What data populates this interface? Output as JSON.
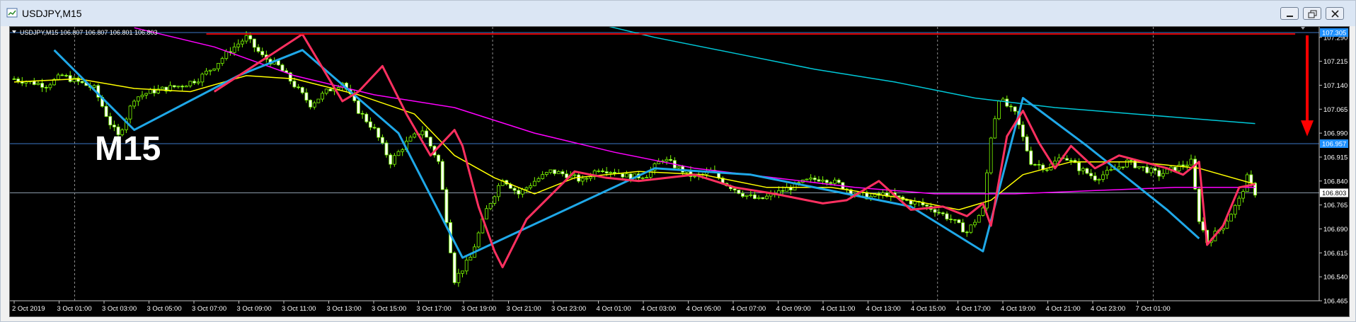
{
  "window": {
    "title": "USDJPY,M15",
    "minimize_icon": "minimize-icon",
    "restore_icon": "restore-icon",
    "close_icon": "close-icon"
  },
  "chart_header": {
    "symbol_info": "USDJPY,M15  106.807 106.807 106.801 106.803"
  },
  "overlay_label": "M15",
  "colors": {
    "background": "#000000",
    "candles": "#7cfc00",
    "ma_yellow": "#ffff00",
    "ma_magenta": "#ff00ff",
    "ma_cyan": "#00c8d8",
    "zigzag_blue": "#1fa8e8",
    "zigzag_red": "#ff3060",
    "resistance_line": "#dd0000",
    "arrow": "#ff0000",
    "hline": "#3c78c8",
    "grid": "#8c8c8c",
    "price_marker_blue": "#1e90ff",
    "current_price_marker": "#ffffff"
  },
  "chart_data": {
    "type": "line",
    "symbol": "USDJPY",
    "timeframe": "M15",
    "ylim": [
      106.465,
      107.305
    ],
    "y_ticks": [
      "107.290",
      "107.215",
      "107.140",
      "107.065",
      "106.990",
      "106.915",
      "106.840",
      "106.765",
      "106.690",
      "106.615",
      "106.540",
      "106.465"
    ],
    "x_ticks": [
      "2 Oct 2019",
      "3 Oct 01:00",
      "3 Oct 03:00",
      "3 Oct 05:00",
      "3 Oct 07:00",
      "3 Oct 09:00",
      "3 Oct 11:00",
      "3 Oct 13:00",
      "3 Oct 15:00",
      "3 Oct 17:00",
      "3 Oct 19:00",
      "3 Oct 21:00",
      "3 Oct 23:00",
      "4 Oct 01:00",
      "4 Oct 03:00",
      "4 Oct 05:00",
      "4 Oct 07:00",
      "4 Oct 09:00",
      "4 Oct 11:00",
      "4 Oct 13:00",
      "4 Oct 15:00",
      "4 Oct 17:00",
      "4 Oct 19:00",
      "4 Oct 21:00",
      "4 Oct 23:00",
      "7 Oct 01:00"
    ],
    "price_markers": [
      {
        "label": "107.305",
        "value": 107.305,
        "style": "blue"
      },
      {
        "label": "106.957",
        "value": 106.957,
        "style": "blue"
      },
      {
        "label": "106.803",
        "value": 106.803,
        "style": "current"
      }
    ],
    "horizontal_lines": [
      107.305,
      106.957,
      106.803
    ],
    "close_series": [
      [
        0,
        107.16
      ],
      [
        2,
        107.15
      ],
      [
        4,
        107.14
      ],
      [
        6,
        107.17
      ],
      [
        8,
        107.15
      ],
      [
        10,
        107.13
      ],
      [
        12,
        107.02
      ],
      [
        13,
        106.98
      ],
      [
        15,
        107.1
      ],
      [
        17,
        107.12
      ],
      [
        19,
        107.13
      ],
      [
        21,
        107.14
      ],
      [
        23,
        107.16
      ],
      [
        25,
        107.2
      ],
      [
        27,
        107.25
      ],
      [
        29,
        107.29
      ],
      [
        31,
        107.23
      ],
      [
        33,
        107.2
      ],
      [
        35,
        107.14
      ],
      [
        37,
        107.08
      ],
      [
        39,
        107.12
      ],
      [
        41,
        107.15
      ],
      [
        43,
        107.06
      ],
      [
        45,
        107.0
      ],
      [
        47,
        106.9
      ],
      [
        49,
        106.96
      ],
      [
        51,
        107.0
      ],
      [
        53,
        106.9
      ],
      [
        54,
        106.72
      ],
      [
        55,
        106.53
      ],
      [
        57,
        106.6
      ],
      [
        59,
        106.75
      ],
      [
        61,
        106.85
      ],
      [
        63,
        106.8
      ],
      [
        65,
        106.84
      ],
      [
        67,
        106.87
      ],
      [
        69,
        106.86
      ],
      [
        71,
        106.84
      ],
      [
        73,
        106.88
      ],
      [
        75,
        106.87
      ],
      [
        77,
        106.85
      ],
      [
        79,
        106.86
      ],
      [
        81,
        106.91
      ],
      [
        83,
        106.88
      ],
      [
        85,
        106.85
      ],
      [
        87,
        106.87
      ],
      [
        89,
        106.83
      ],
      [
        91,
        106.8
      ],
      [
        93,
        106.78
      ],
      [
        95,
        106.8
      ],
      [
        97,
        106.82
      ],
      [
        99,
        106.84
      ],
      [
        101,
        106.85
      ],
      [
        103,
        106.83
      ],
      [
        105,
        106.8
      ],
      [
        107,
        106.79
      ],
      [
        109,
        106.8
      ],
      [
        111,
        106.78
      ],
      [
        113,
        106.77
      ],
      [
        115,
        106.75
      ],
      [
        117,
        106.72
      ],
      [
        119,
        106.68
      ],
      [
        121,
        106.75
      ],
      [
        122,
        106.98
      ],
      [
        123,
        107.1
      ],
      [
        125,
        107.05
      ],
      [
        127,
        106.9
      ],
      [
        129,
        106.88
      ],
      [
        131,
        106.92
      ],
      [
        133,
        106.88
      ],
      [
        135,
        106.85
      ],
      [
        137,
        106.87
      ],
      [
        139,
        106.9
      ],
      [
        141,
        106.88
      ],
      [
        143,
        106.86
      ],
      [
        145,
        106.88
      ],
      [
        147,
        106.9
      ],
      [
        148,
        106.72
      ],
      [
        149,
        106.65
      ],
      [
        151,
        106.7
      ],
      [
        153,
        106.78
      ],
      [
        154,
        106.85
      ],
      [
        155,
        106.803
      ]
    ],
    "ma_yellow": [
      [
        0,
        107.15
      ],
      [
        8,
        107.16
      ],
      [
        15,
        107.13
      ],
      [
        22,
        107.12
      ],
      [
        29,
        107.17
      ],
      [
        35,
        107.16
      ],
      [
        43,
        107.11
      ],
      [
        50,
        107.05
      ],
      [
        55,
        106.92
      ],
      [
        60,
        106.85
      ],
      [
        65,
        106.8
      ],
      [
        70,
        106.85
      ],
      [
        78,
        106.87
      ],
      [
        86,
        106.86
      ],
      [
        94,
        106.82
      ],
      [
        102,
        106.82
      ],
      [
        110,
        106.79
      ],
      [
        118,
        106.75
      ],
      [
        122,
        106.78
      ],
      [
        126,
        106.86
      ],
      [
        132,
        106.9
      ],
      [
        140,
        106.9
      ],
      [
        148,
        106.88
      ],
      [
        155,
        106.83
      ]
    ],
    "ma_magenta": [
      [
        15,
        107.32
      ],
      [
        25,
        107.26
      ],
      [
        35,
        107.17
      ],
      [
        45,
        107.11
      ],
      [
        55,
        107.07
      ],
      [
        65,
        106.99
      ],
      [
        75,
        106.93
      ],
      [
        85,
        106.88
      ],
      [
        95,
        106.85
      ],
      [
        105,
        106.82
      ],
      [
        115,
        106.8
      ],
      [
        125,
        106.8
      ],
      [
        135,
        106.81
      ],
      [
        145,
        106.82
      ],
      [
        155,
        106.82
      ]
    ],
    "ma_cyan": [
      [
        60,
        107.42
      ],
      [
        70,
        107.35
      ],
      [
        80,
        107.29
      ],
      [
        90,
        107.24
      ],
      [
        100,
        107.19
      ],
      [
        110,
        107.15
      ],
      [
        120,
        107.1
      ],
      [
        130,
        107.07
      ],
      [
        140,
        107.05
      ],
      [
        150,
        107.03
      ],
      [
        155,
        107.02
      ]
    ],
    "zigzag_blue": [
      [
        5,
        107.25
      ],
      [
        15,
        107.0
      ],
      [
        28,
        107.17
      ],
      [
        36,
        107.25
      ],
      [
        48,
        106.99
      ],
      [
        56,
        106.6
      ],
      [
        62,
        106.67
      ],
      [
        80,
        106.88
      ],
      [
        92,
        106.86
      ],
      [
        112,
        106.76
      ],
      [
        121,
        106.62
      ],
      [
        126,
        107.1
      ],
      [
        134,
        106.95
      ],
      [
        144,
        106.75
      ],
      [
        148,
        106.66
      ]
    ],
    "zigzag_red": [
      [
        25,
        107.12
      ],
      [
        36,
        107.3
      ],
      [
        41,
        107.09
      ],
      [
        43,
        107.12
      ],
      [
        46,
        107.2
      ],
      [
        49,
        107.05
      ],
      [
        52,
        106.92
      ],
      [
        55,
        107.0
      ],
      [
        56,
        106.95
      ],
      [
        58,
        106.76
      ],
      [
        60,
        106.62
      ],
      [
        61,
        106.57
      ],
      [
        64,
        106.72
      ],
      [
        70,
        106.87
      ],
      [
        74,
        106.85
      ],
      [
        78,
        106.84
      ],
      [
        85,
        106.86
      ],
      [
        90,
        106.82
      ],
      [
        95,
        106.8
      ],
      [
        101,
        106.77
      ],
      [
        104,
        106.78
      ],
      [
        108,
        106.84
      ],
      [
        112,
        106.75
      ],
      [
        116,
        106.76
      ],
      [
        119,
        106.73
      ],
      [
        121,
        106.77
      ],
      [
        122,
        106.7
      ],
      [
        124,
        106.98
      ],
      [
        126,
        107.06
      ],
      [
        128,
        106.96
      ],
      [
        130,
        106.88
      ],
      [
        132,
        106.95
      ],
      [
        135,
        106.88
      ],
      [
        138,
        106.92
      ],
      [
        141,
        106.9
      ],
      [
        144,
        106.88
      ],
      [
        146,
        106.86
      ],
      [
        148,
        106.9
      ],
      [
        149,
        106.64
      ],
      [
        151,
        106.7
      ],
      [
        153,
        106.82
      ],
      [
        155,
        106.83
      ]
    ]
  }
}
